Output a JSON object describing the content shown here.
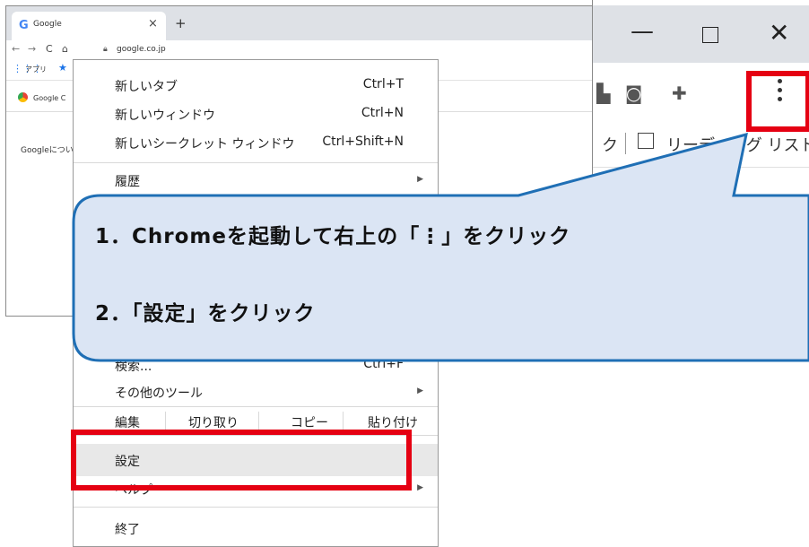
{
  "small_browser": {
    "tab_title": "Google",
    "tab_close": "×",
    "new_tab": "+",
    "url": "google.co.jp",
    "apps_label": "アプリ",
    "page_tab_label": "Google C",
    "page_about": "Googleについ"
  },
  "large_browser": {
    "minimize": "—",
    "close": "✕",
    "bookmark_fragment": "ク",
    "reading_list": "リーディング リスト"
  },
  "menu": {
    "items": [
      {
        "label": "新しいタブ",
        "shortcut": "Ctrl+T"
      },
      {
        "label": "新しいウィンドウ",
        "shortcut": "Ctrl+N"
      },
      {
        "label": "新しいシークレット ウィンドウ",
        "shortcut": "Ctrl+Shift+N"
      },
      {
        "label": "履歴",
        "submenu": true
      },
      {
        "label": "検索...",
        "shortcut": "Ctrl+F"
      },
      {
        "label": "その他のツール",
        "submenu": true
      },
      {
        "label": "設定"
      },
      {
        "label": "ヘルプ",
        "submenu": true
      },
      {
        "label": "終了"
      }
    ],
    "edit_row": {
      "label": "編集",
      "cut": "切り取り",
      "copy": "コピー",
      "paste": "貼り付け"
    }
  },
  "callout": {
    "line1": "1．Chromeを起動して右上の「⋮」をクリック",
    "line2": "2．「設定」をクリック",
    "fill": "#dbe5f4",
    "stroke": "#1f6fb5"
  },
  "highlight_color": "#e50012"
}
